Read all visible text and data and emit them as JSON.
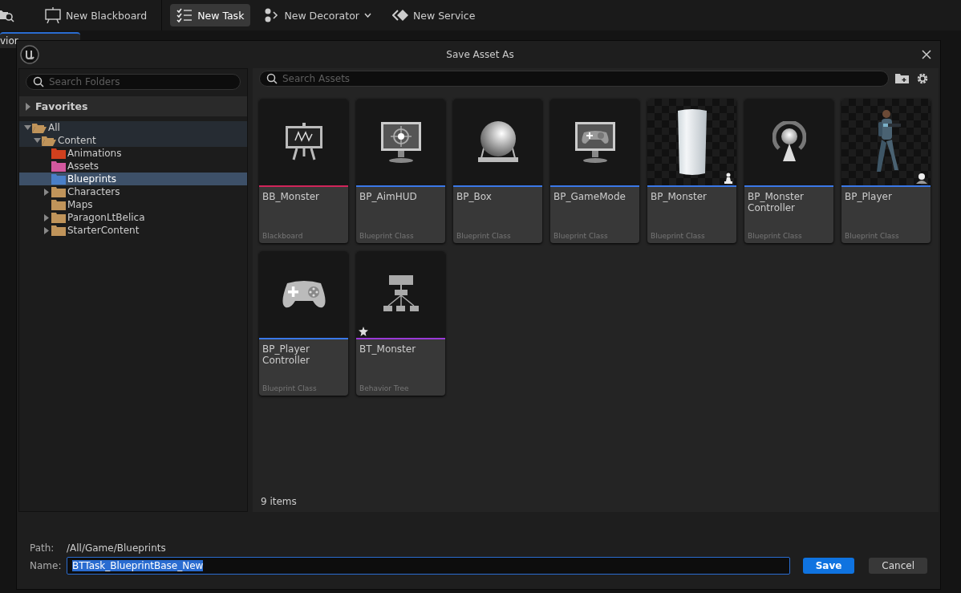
{
  "toolbar": {
    "items": [
      {
        "label": "New Blackboard",
        "kind": "easel",
        "selected": false,
        "dropdown": false
      },
      {
        "label": "New Task",
        "kind": "checklist",
        "selected": true,
        "dropdown": false
      },
      {
        "label": "New Decorator",
        "kind": "decorator",
        "selected": false,
        "dropdown": true
      },
      {
        "label": "New Service",
        "kind": "diamonds",
        "selected": false,
        "dropdown": false
      }
    ]
  },
  "editor_tab": {
    "label": "vior"
  },
  "dialog": {
    "title": "Save Asset As",
    "folder_search": {
      "placeholder": "Search Folders"
    },
    "favorites": {
      "label": "Favorites",
      "expanded": false
    },
    "folders": [
      {
        "label": "All",
        "kind": "branch",
        "expanded": true,
        "color": "#c0945a",
        "selected": false,
        "children": [
          {
            "label": "Content",
            "kind": "branch",
            "expanded": true,
            "color": "#c0945a",
            "selected": false,
            "children": [
              {
                "label": "Animations",
                "kind": "leaf",
                "color": "#d0401e",
                "selected": false
              },
              {
                "label": "Assets",
                "kind": "leaf",
                "color": "#d2589e",
                "selected": false
              },
              {
                "label": "Blueprints",
                "kind": "leaf",
                "color": "#4a7fc8",
                "selected": true
              },
              {
                "label": "Characters",
                "kind": "branch",
                "expanded": false,
                "color": "#c0945a",
                "selected": false
              },
              {
                "label": "Maps",
                "kind": "leaf",
                "color": "#c0945a",
                "selected": false
              },
              {
                "label": "ParagonLtBelica",
                "kind": "branch",
                "expanded": false,
                "color": "#c0945a",
                "selected": false
              },
              {
                "label": "StarterContent",
                "kind": "branch",
                "expanded": false,
                "color": "#c0945a",
                "selected": false
              }
            ]
          }
        ]
      }
    ],
    "asset_search": {
      "placeholder": "Search Assets"
    },
    "assets": [
      {
        "name": "BB_Monster",
        "type": "Blackboard",
        "color": "#d0245a",
        "kind": "easel",
        "selected": false
      },
      {
        "name": "BP_AimHUD",
        "type": "Blueprint Class",
        "color": "#3a78e8",
        "kind": "target",
        "selected": false
      },
      {
        "name": "BP_Box",
        "type": "Blueprint Class",
        "color": "#3a78e8",
        "kind": "sphere",
        "selected": false
      },
      {
        "name": "BP_GameMode",
        "type": "Blueprint Class",
        "color": "#3a78e8",
        "kind": "gamemode",
        "selected": false
      },
      {
        "name": "BP_Monster",
        "type": "Blueprint Class",
        "color": "#3a78e8",
        "kind": "pawn",
        "selected": false
      },
      {
        "name": "BP_Monster Controller",
        "type": "Blueprint Class",
        "color": "#3a78e8",
        "kind": "controller",
        "selected": false
      },
      {
        "name": "BP_Player",
        "type": "Blueprint Class",
        "color": "#3a78e8",
        "kind": "character",
        "selected": false
      },
      {
        "name": "BP_Player Controller",
        "type": "Blueprint Class",
        "color": "#3a78e8",
        "kind": "gamepad",
        "selected": false
      },
      {
        "name": "BT_Monster",
        "type": "Behavior Tree",
        "color": "#9a3ad8",
        "kind": "tree",
        "selected": false
      }
    ],
    "item_count": "9 items",
    "path_label": "Path:",
    "path_value": "/All/Game/Blueprints",
    "name_label": "Name:",
    "name_value": "BTTask_BlueprintBase_New",
    "name_text_selected": true,
    "buttons": [
      {
        "label": "Save",
        "kind": "primary"
      },
      {
        "label": "Cancel",
        "kind": "secondary"
      }
    ]
  }
}
